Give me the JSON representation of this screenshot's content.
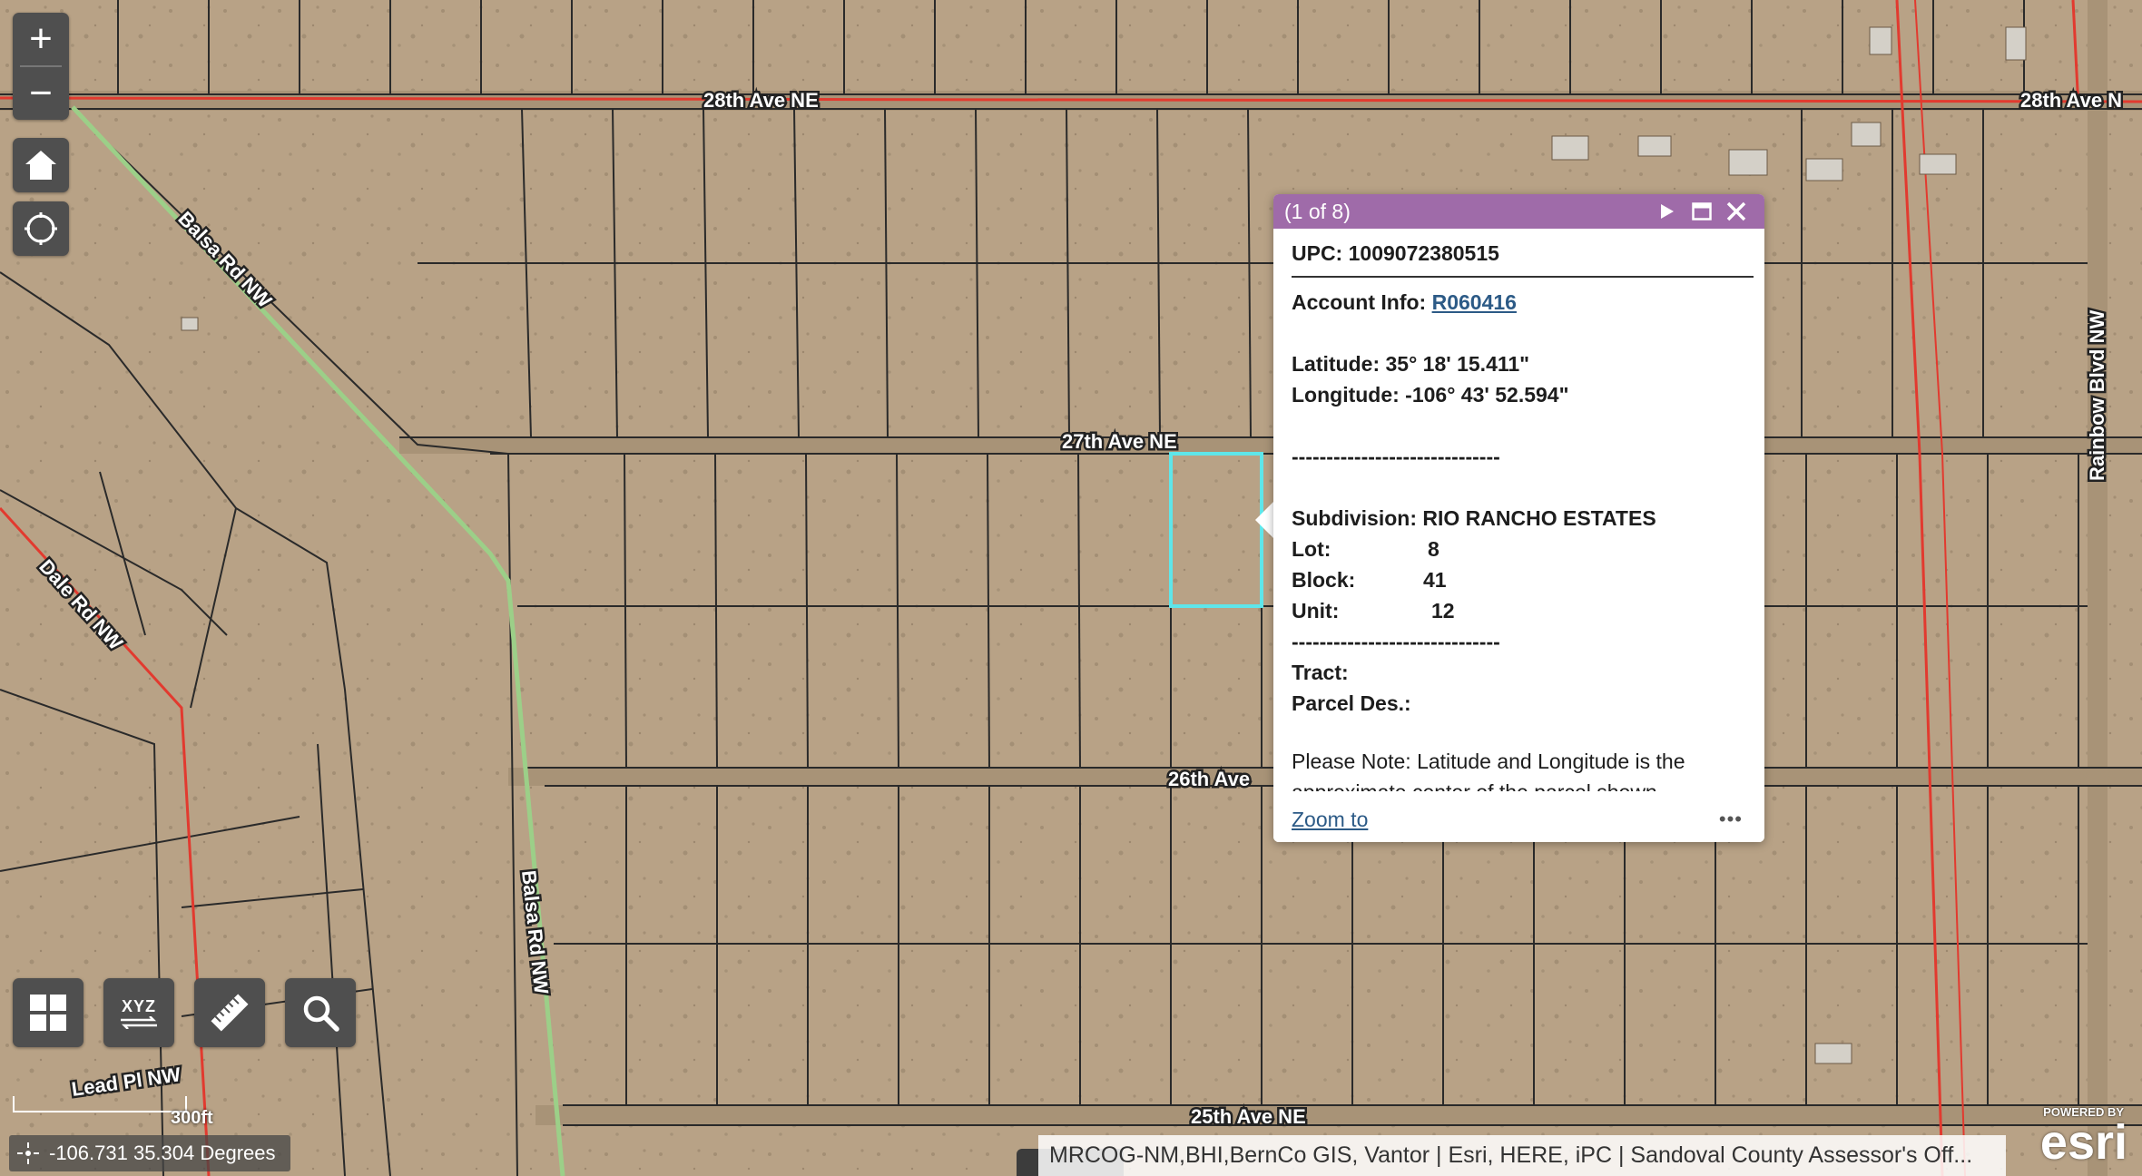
{
  "map": {
    "roads": {
      "r28": "28th Ave NE",
      "r28_east": "28th Ave N",
      "r27": "27th Ave NE",
      "r26": "26th Ave",
      "r25": "25th Ave NE",
      "balsa_upper": "Balsa Rd NW",
      "balsa_lower": "Balsa Rd NW",
      "dale": "Dale Rd NW",
      "rainbow": "Rainbow Blvd NW",
      "lead": "Lead Pl NW"
    },
    "colors": {
      "parcel_line": "#2a2a2a",
      "road_fill": "#a89377",
      "boundary_red": "#e23a2f",
      "green_road": "#9ccf88",
      "highlight": "#5ee6ea"
    }
  },
  "controls": {
    "zoom_in": "+",
    "zoom_out": "−",
    "home_icon": "home-icon",
    "locate_icon": "locate-icon",
    "basemap_icon": "grid-icon",
    "xyz_label": "XYZ",
    "measure_icon": "ruler-icon",
    "search_icon": "search-icon"
  },
  "popup": {
    "counter": "(1 of 8)",
    "upc": "UPC: 1009072380515",
    "account_label": "Account Info:",
    "account_value": "R060416",
    "latitude": "Latitude: 35° 18' 15.411\"",
    "longitude": "Longitude: -106° 43' 52.594\"",
    "divider1": "------------------------------",
    "subdivision": "Subdivision: RIO RANCHO ESTATES",
    "lot_label": "Lot:",
    "lot_value": "8",
    "block_label": "Block:",
    "block_value": "41",
    "unit_label": "Unit:",
    "unit_value": "12",
    "divider2": "------------------------------",
    "tract": "Tract:",
    "parcel_des": "Parcel Des.:",
    "note_line1": "Please Note: Latitude and Longitude is the",
    "note_line2": "approximate center of the parcel shown",
    "zoom_to": "Zoom to",
    "more": "•••"
  },
  "scale": {
    "label": "300ft"
  },
  "coords": {
    "text": "-106.731 35.304 Degrees"
  },
  "attribution": {
    "text": "MRCOG-NM,BHI,BernCo GIS, Vantor | Esri, HERE, iPC | Sandoval County Assessor's Off..."
  },
  "logo": {
    "powered_by": "POWERED BY",
    "esri": "esri"
  }
}
